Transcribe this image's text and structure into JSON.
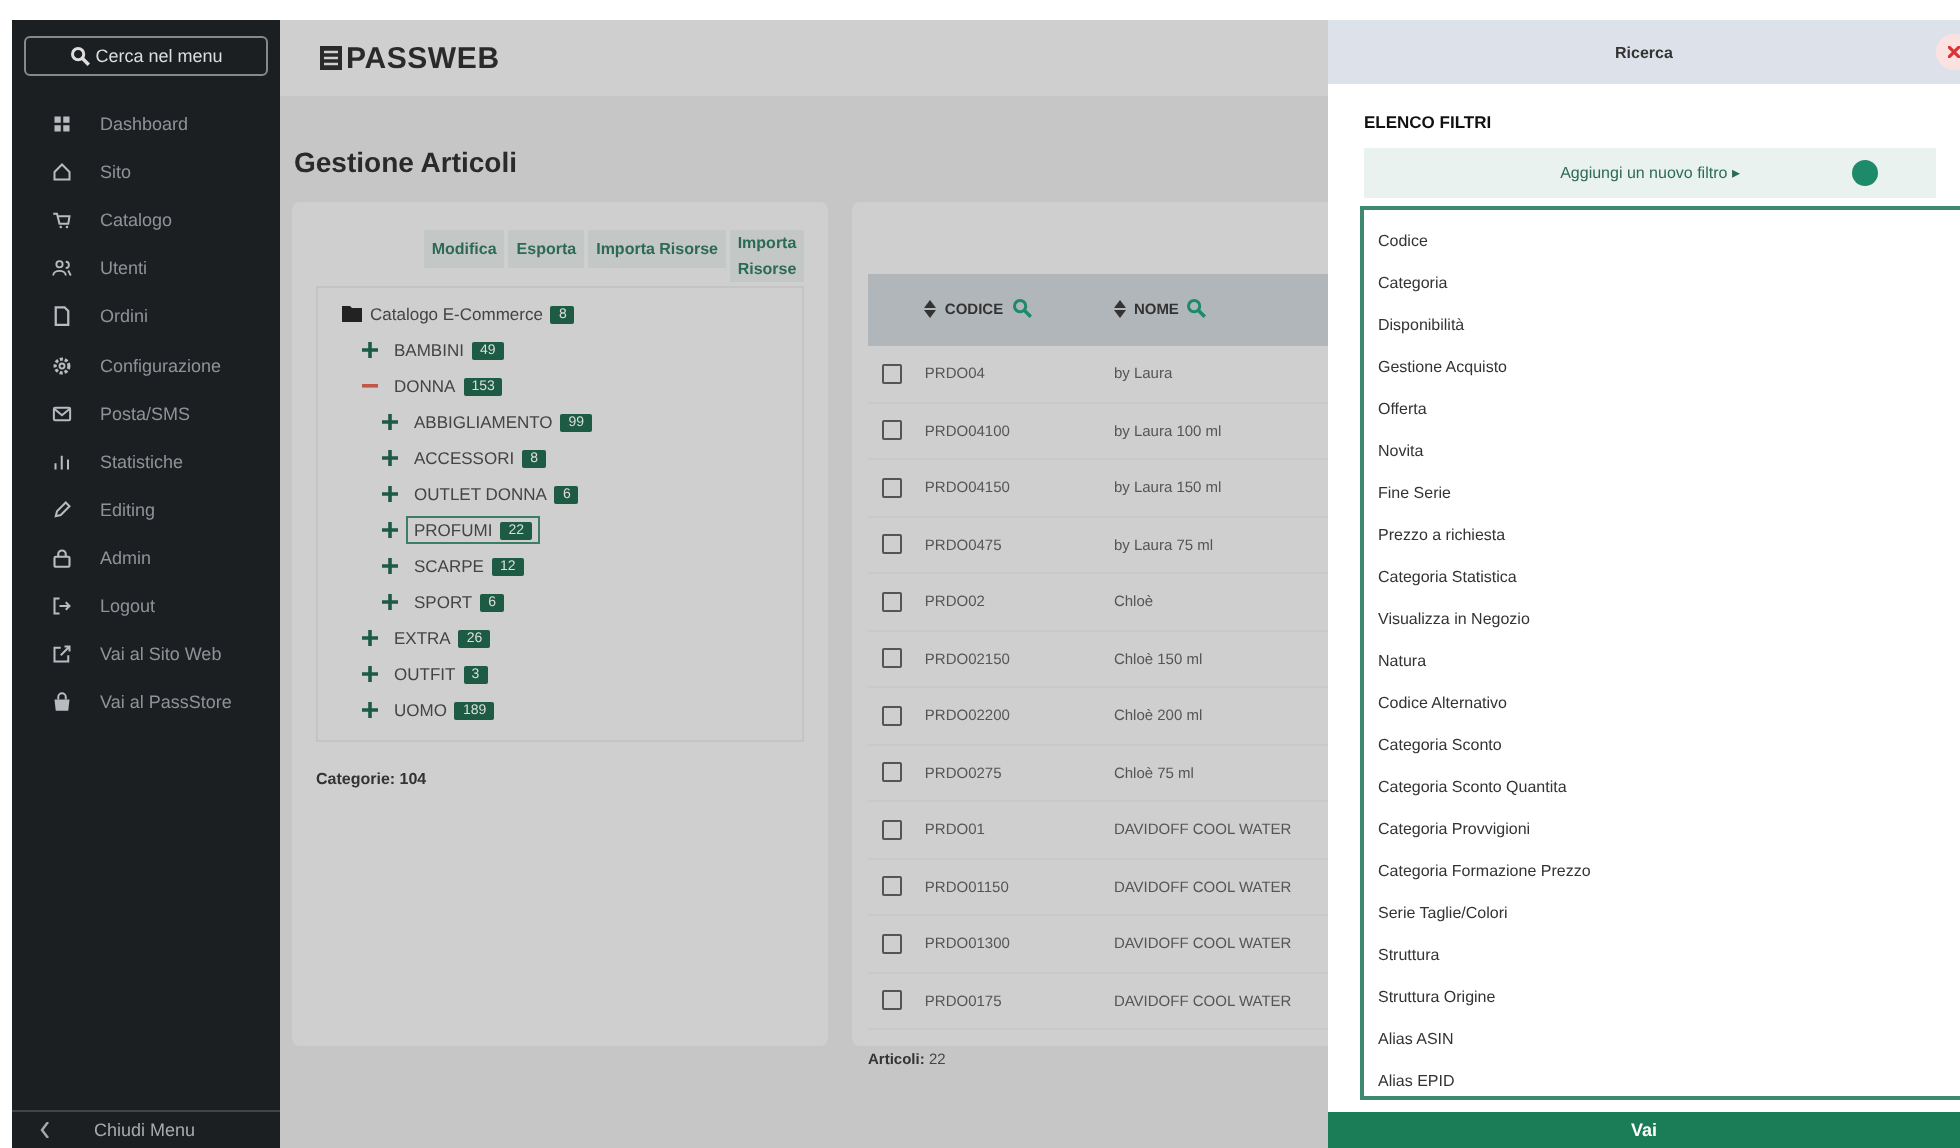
{
  "sidebar": {
    "search_button": "Cerca nel menu",
    "items": [
      {
        "label": "Dashboard",
        "kind": "dashboard"
      },
      {
        "label": "Sito",
        "kind": "home"
      },
      {
        "label": "Catalogo",
        "kind": "cart"
      },
      {
        "label": "Utenti",
        "kind": "users"
      },
      {
        "label": "Ordini",
        "kind": "document"
      },
      {
        "label": "Configurazione",
        "kind": "gear"
      },
      {
        "label": "Posta/SMS",
        "kind": "mail"
      },
      {
        "label": "Statistiche",
        "kind": "bars"
      },
      {
        "label": "Editing",
        "kind": "pencil"
      },
      {
        "label": "Admin",
        "kind": "lock"
      },
      {
        "label": "Logout",
        "kind": "logout"
      },
      {
        "label": "Vai al Sito Web",
        "kind": "external"
      },
      {
        "label": "Vai al PassStore",
        "kind": "bag"
      }
    ],
    "collapse": "Chiudi Menu"
  },
  "header": {
    "logo": "PASSWEB"
  },
  "page_title": "Gestione Articoli",
  "categories_card": {
    "buttons": [
      "Modifica",
      "Esporta",
      "Importa Risorse",
      "Importa Risorse"
    ],
    "tree": {
      "label": "Catalogo E-Commerce",
      "count": "8",
      "children": [
        {
          "label": "BAMBINI",
          "count": "49",
          "expanded": false,
          "selected": false
        },
        {
          "label": "DONNA",
          "count": "153",
          "expanded": true,
          "selected": false,
          "children": [
            {
              "label": "ABBIGLIAMENTO",
              "count": "99",
              "expanded": false,
              "selected": false
            },
            {
              "label": "ACCESSORI",
              "count": "8",
              "expanded": false,
              "selected": false
            },
            {
              "label": "OUTLET DONNA",
              "count": "6",
              "expanded": false,
              "selected": false
            },
            {
              "label": "PROFUMI",
              "count": "22",
              "expanded": false,
              "selected": true
            },
            {
              "label": "SCARPE",
              "count": "12",
              "expanded": false,
              "selected": false
            },
            {
              "label": "SPORT",
              "count": "6",
              "expanded": false,
              "selected": false
            }
          ]
        },
        {
          "label": "EXTRA",
          "count": "26",
          "expanded": false,
          "selected": false
        },
        {
          "label": "OUTFIT",
          "count": "3",
          "expanded": false,
          "selected": false
        },
        {
          "label": "UOMO",
          "count": "189",
          "expanded": false,
          "selected": false
        }
      ]
    },
    "footer": "Categorie: 104"
  },
  "articles_card": {
    "columns": [
      "CODICE",
      "NOME"
    ],
    "rows": [
      {
        "checked": false,
        "codice": "PRDO04",
        "nome": "by Laura"
      },
      {
        "checked": false,
        "codice": "PRDO04100",
        "nome": "by Laura 100 ml"
      },
      {
        "checked": false,
        "codice": "PRDO04150",
        "nome": "by Laura 150 ml"
      },
      {
        "checked": false,
        "codice": "PRDO0475",
        "nome": "by Laura 75 ml"
      },
      {
        "checked": false,
        "codice": "PRDO02",
        "nome": "Chloè"
      },
      {
        "checked": false,
        "codice": "PRDO02150",
        "nome": "Chloè 150 ml"
      },
      {
        "checked": false,
        "codice": "PRDO02200",
        "nome": "Chloè 200 ml"
      },
      {
        "checked": false,
        "codice": "PRDO0275",
        "nome": "Chloè 75 ml"
      },
      {
        "checked": false,
        "codice": "PRDO01",
        "nome": "DAVIDOFF COOL WATER"
      },
      {
        "checked": false,
        "codice": "PRDO01150",
        "nome": "DAVIDOFF COOL WATER"
      },
      {
        "checked": false,
        "codice": "PRDO01300",
        "nome": "DAVIDOFF COOL WATER"
      },
      {
        "checked": false,
        "codice": "PRDO0175",
        "nome": "DAVIDOFF COOL WATER"
      }
    ],
    "footer_label": "Articoli:",
    "footer_value": "22"
  },
  "search_panel": {
    "title": "Ricerca",
    "section": "ELENCO FILTRI",
    "add_filter": "Aggiungi un nuovo filtro ▸",
    "filters": [
      "Codice",
      "Categoria",
      "Disponibilità",
      "Gestione Acquisto",
      "Offerta",
      "Novita",
      "Fine Serie",
      "Prezzo a richiesta",
      "Categoria Statistica",
      "Visualizza in Negozio",
      "Natura",
      "Codice Alternativo",
      "Categoria Sconto",
      "Categoria Sconto Quantita",
      "Categoria Provvigioni",
      "Categoria Formazione Prezzo",
      "Serie Taglie/Colori",
      "Struttura",
      "Struttura Origine",
      "Alias ASIN",
      "Alias EPID"
    ],
    "submit": "Vai"
  }
}
